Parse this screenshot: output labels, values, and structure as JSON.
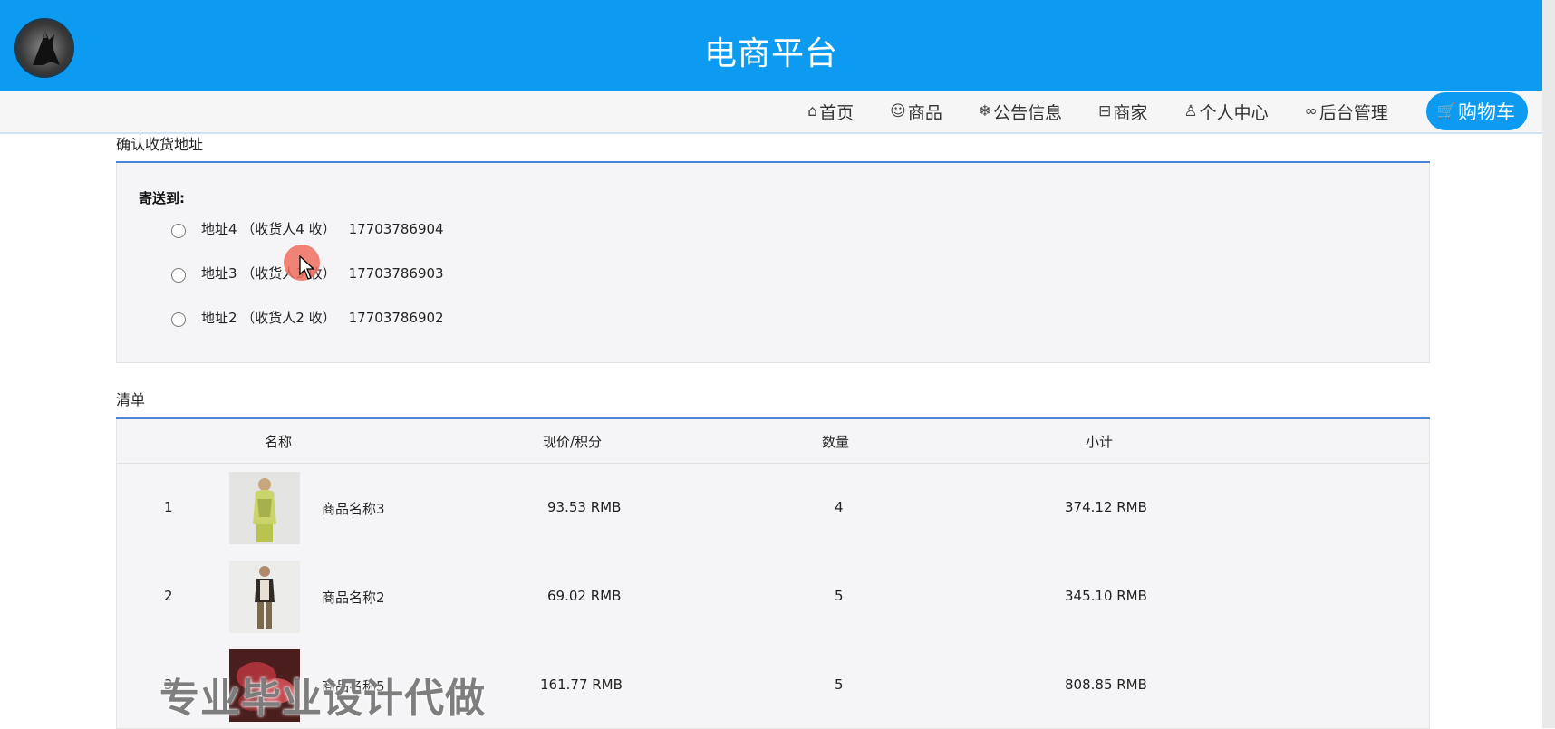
{
  "header": {
    "title": "电商平台"
  },
  "nav": {
    "items": [
      {
        "icon": "home-icon",
        "glyph": "⌂",
        "label": "首页"
      },
      {
        "icon": "smile-icon",
        "glyph": "☺",
        "label": "商品"
      },
      {
        "icon": "snowflake-icon",
        "glyph": "❄",
        "label": "公告信息"
      },
      {
        "icon": "store-icon",
        "glyph": "⊟",
        "label": "商家"
      },
      {
        "icon": "user-icon",
        "glyph": "♙",
        "label": "个人中心"
      },
      {
        "icon": "link-icon",
        "glyph": "∞",
        "label": "后台管理"
      }
    ],
    "cart": {
      "icon": "cart-icon",
      "glyph": "🛒",
      "label": "购物车"
    }
  },
  "address": {
    "section_title": "确认收货地址",
    "send_to_label": "寄送到:",
    "options": [
      {
        "text": "地址4 （收货人4 收）",
        "phone": "17703786904"
      },
      {
        "text": "地址3 （收货人3 收）",
        "phone": "17703786903"
      },
      {
        "text": "地址2 （收货人2 收）",
        "phone": "17703786902"
      }
    ]
  },
  "order": {
    "section_title": "清单",
    "columns": {
      "name": "名称",
      "price": "现价/积分",
      "qty": "数量",
      "subtotal": "小计"
    },
    "rows": [
      {
        "index": "1",
        "name": "商品名称3",
        "price": "93.53 RMB",
        "qty": "4",
        "subtotal": "374.12 RMB"
      },
      {
        "index": "2",
        "name": "商品名称2",
        "price": "69.02 RMB",
        "qty": "5",
        "subtotal": "345.10 RMB"
      },
      {
        "index": "3",
        "name": "商品名称5",
        "price": "161.77 RMB",
        "qty": "5",
        "subtotal": "808.85 RMB"
      }
    ]
  },
  "overlay": {
    "watermark": "专业毕业设计代做"
  },
  "colors": {
    "primary": "#0d9bf2",
    "section_line": "#4a84d8",
    "panel_bg": "#f5f5f7"
  }
}
